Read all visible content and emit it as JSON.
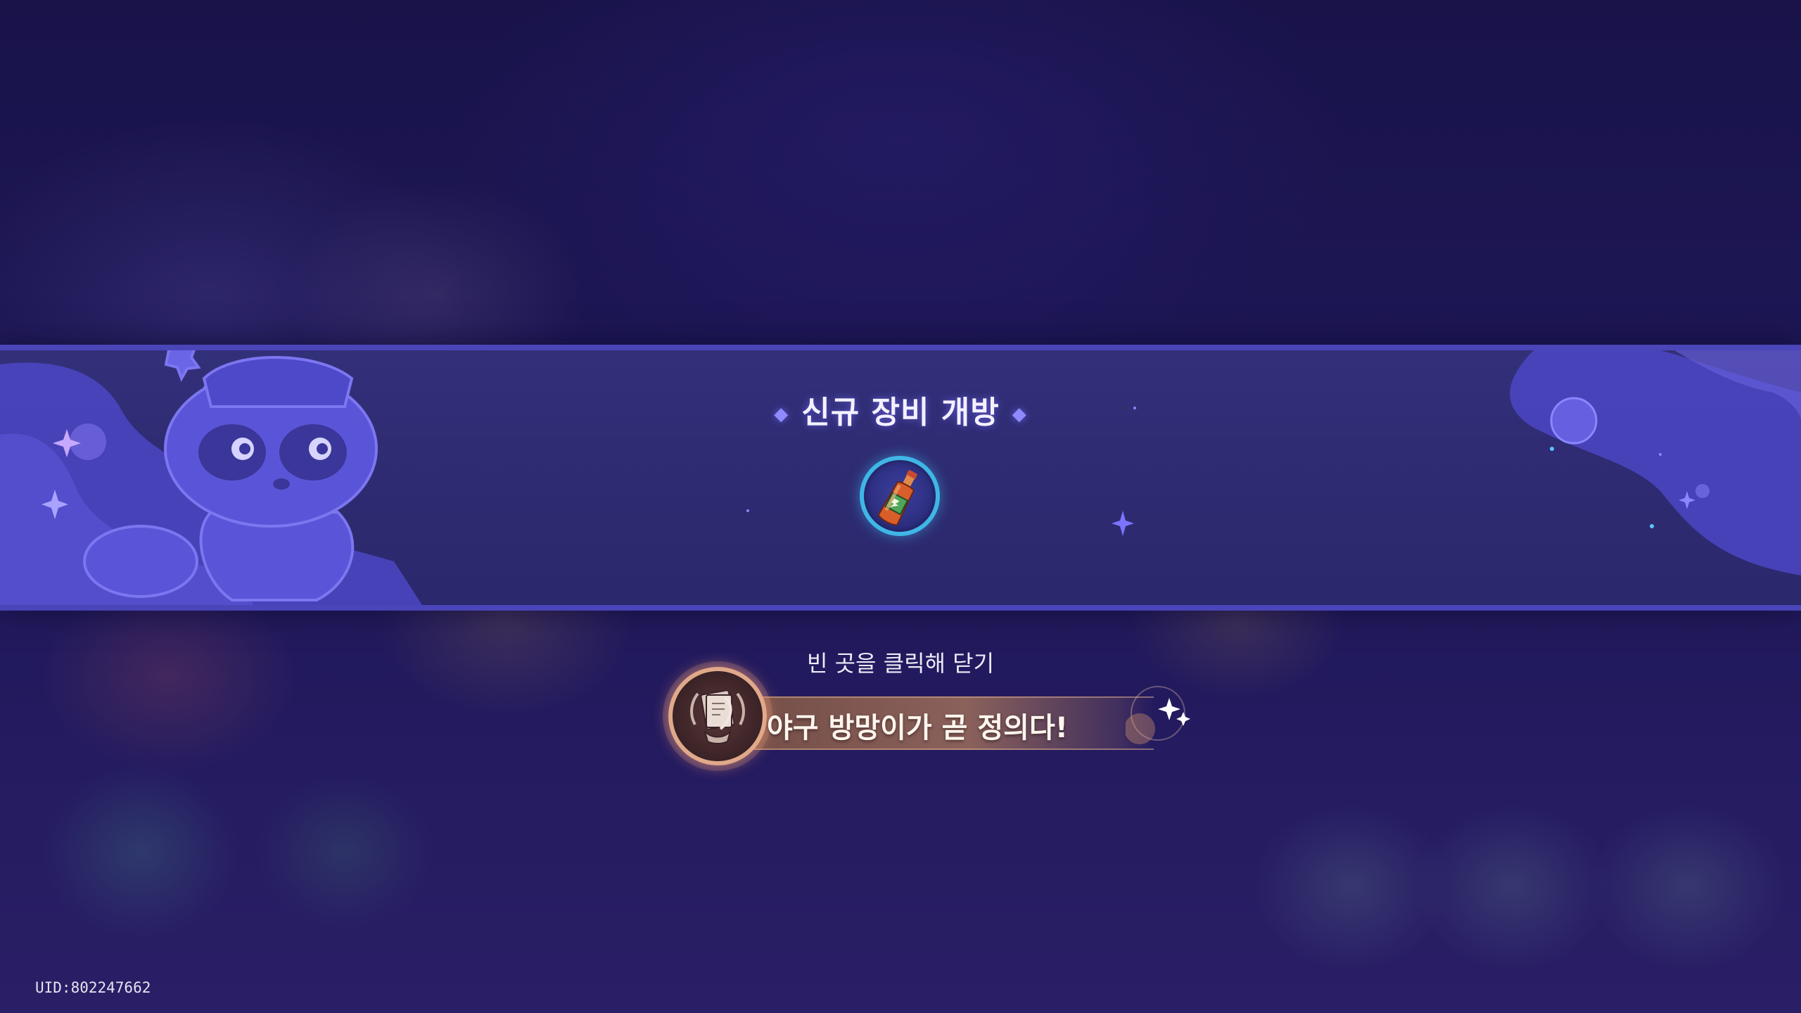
{
  "banner": {
    "title": "신규 장비 개방",
    "item_icon": "hot-sauce-bottle-icon"
  },
  "hint": {
    "close_text": "빈 곳을 클릭해 닫기"
  },
  "achievement": {
    "title": "야구 방망이가 곧 정의다!",
    "icon": "scroll-badge-icon"
  },
  "footer": {
    "uid": "UID:802247662"
  },
  "colors": {
    "banner_border": "#4a45b8",
    "banner_fill": "#2e2b72",
    "slot_ring": "#3fb7e6",
    "achievement_ring": "#e0a989"
  }
}
